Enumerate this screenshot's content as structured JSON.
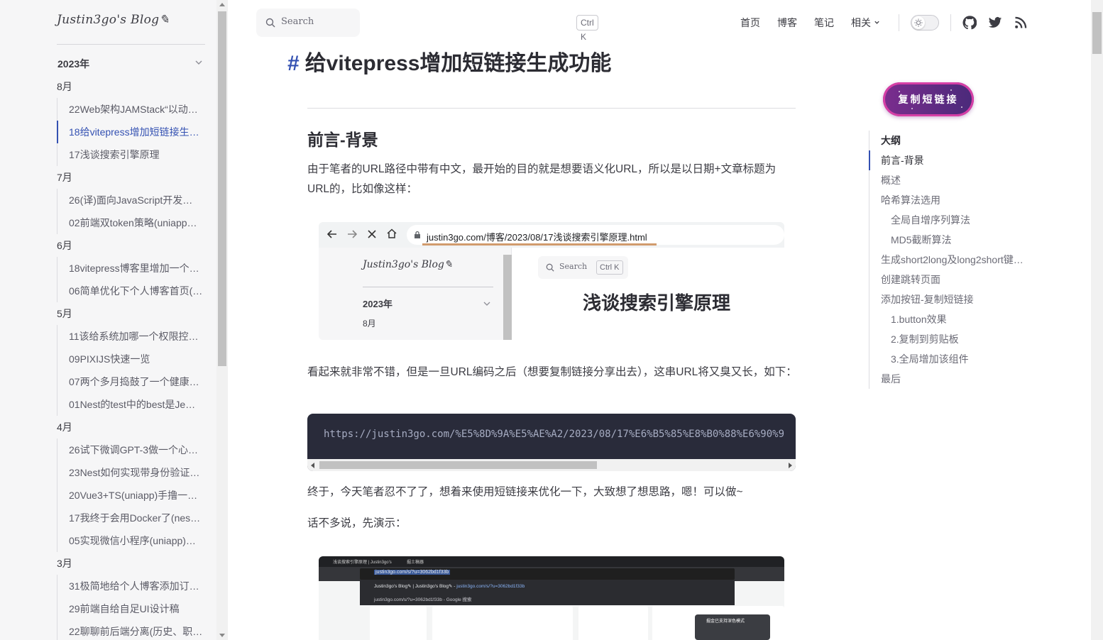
{
  "sidebar": {
    "logo": "Justin3go's Blog✎",
    "year": "2023年",
    "groups": [
      {
        "month": "8月",
        "items": [
          "22Web架构JAMStack“以动…",
          "18给vitepress增加短链接生…",
          "17浅谈搜索引擎原理"
        ]
      },
      {
        "month": "7月",
        "items": [
          "26(译)面向JavaScript开发…",
          "02前端双token策略(uniapp…"
        ]
      },
      {
        "month": "6月",
        "items": [
          "18vitepress博客里增加一个…",
          "06简单优化下个人博客首页(…"
        ]
      },
      {
        "month": "5月",
        "items": [
          "11该给系统加哪一个权限控…",
          "09PIXIJS快速一览",
          "07两个多月捣鼓了一个健康…",
          "01Nest的test中的best是Je…"
        ]
      },
      {
        "month": "4月",
        "items": [
          "26试下微调GPT-3做一个心…",
          "23Nest如何实现带身份验证…",
          "20Vue3+TS(uniapp)手撸一…",
          "17我终于会用Docker了(nes…",
          "05实现微信小程序(uniapp)…"
        ]
      },
      {
        "month": "3月",
        "items": [
          "31极简地给个人博客添加订…",
          "29前端自给自足UI设计稿",
          "22聊聊前后端分离(历史、职…"
        ]
      }
    ]
  },
  "header": {
    "search_placeholder": "Search",
    "search_kbd": "Ctrl K",
    "nav": [
      "首页",
      "博客",
      "笔记",
      "相关"
    ]
  },
  "article": {
    "title": "给vitepress增加短链接生成功能",
    "hash": "#",
    "section_heading": "前言-背景",
    "para1": "由于笔者的URL路径中带有中文，最开始的目的就是想要语义化URL，所以是以日期+文章标题为URL的，比如像这样：",
    "para2": "看起来就非常不错，但是一旦URL编码之后（想要复制链接分享出去），这串URL将又臭又长，如下：",
    "code": "https://justin3go.com/%E5%8D%9A%E5%AE%A2/2023/08/17%E6%B5%85%E8%B0%88%E6%90%9",
    "para3": "终于，今天笔者忍不了了，想着来使用短链接来优化一下，大致想了想思路，嗯！可以做~",
    "para4": "话不多说，先演示："
  },
  "screenshot1": {
    "url": "justin3go.com/博客/2023/08/17浅谈搜索引擎原理.html",
    "logo": "Justin3go's Blog✎",
    "year": "2023年",
    "month": "8月",
    "search": "Search",
    "kbd": "Ctrl K",
    "title": "浅谈搜索引擎原理"
  },
  "screenshot2": {
    "tab1": "浅谈搜索引擎原理 | Justin3go's",
    "tab2": "掘土稿器",
    "omnibox": "justin3go.com/s/?u=3062bd1f33b",
    "suggest1_a": "Justin3go's Blog✎ | Justin3go's Blog✎ -",
    "suggest1_b": "justin3go.com/s/?u=3062bd1f33b",
    "suggest2": "justin3go.com/s/?u=3062bd1f33b - Google 搜索",
    "toast": "掘金已支持深色模式"
  },
  "aside": {
    "copy_button": "复制短链接",
    "outline_title": "大纲",
    "outline": [
      {
        "label": "前言-背景",
        "level": 1,
        "active": true
      },
      {
        "label": "概述",
        "level": 1
      },
      {
        "label": "哈希算法选用",
        "level": 1
      },
      {
        "label": "全局自增序列算法",
        "level": 2
      },
      {
        "label": "MD5截断算法",
        "level": 2
      },
      {
        "label": "生成short2long及long2short键…",
        "level": 1
      },
      {
        "label": "创建跳转页面",
        "level": 1
      },
      {
        "label": "添加按钮-复制短链接",
        "level": 1
      },
      {
        "label": "1.button效果",
        "level": 2
      },
      {
        "label": "2.复制到剪贴板",
        "level": 2
      },
      {
        "label": "3.全局增加该组件",
        "level": 2
      },
      {
        "label": "最后",
        "level": 1
      }
    ]
  },
  "colors": {
    "accent": "#3451b2",
    "code_bg": "#292b3a",
    "sidebar_bg": "#f6f6f7"
  },
  "icons": [
    "search-icon",
    "chevron-down-icon",
    "sun-icon",
    "github-icon",
    "twitter-icon",
    "rss-icon"
  ]
}
